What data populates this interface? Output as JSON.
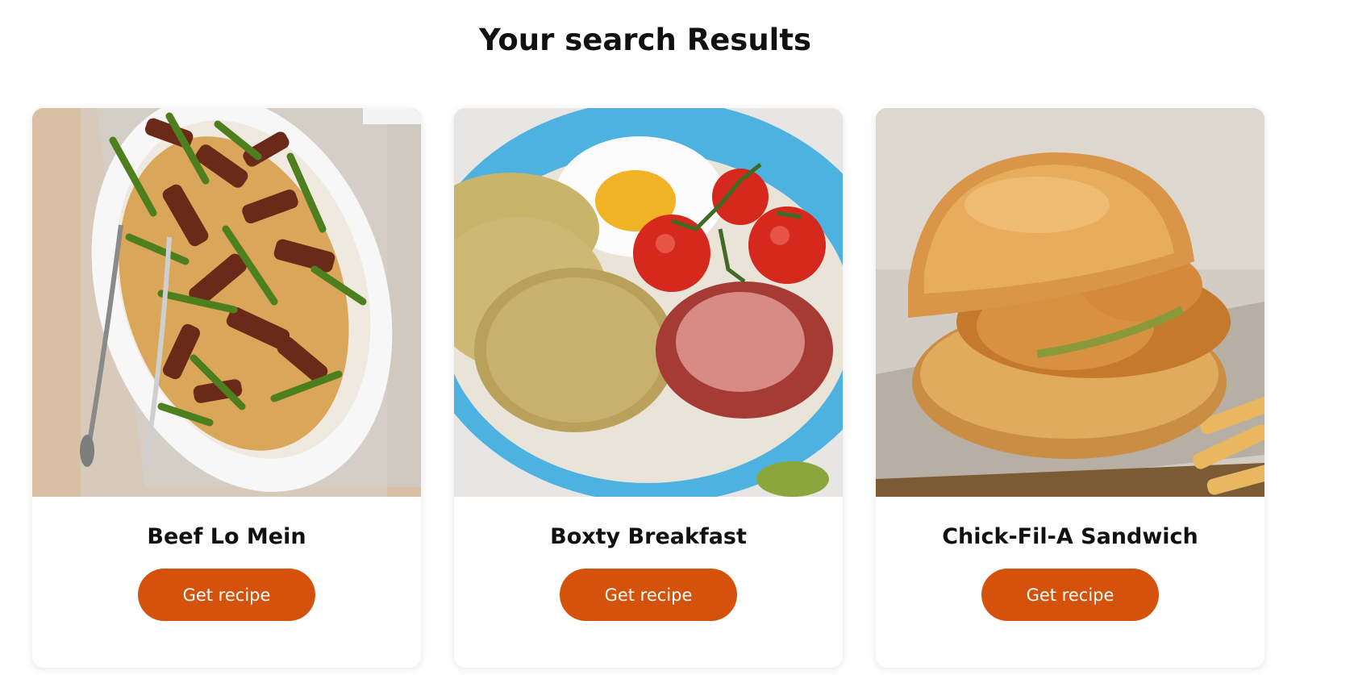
{
  "page": {
    "title": "Your search Results"
  },
  "colors": {
    "accent": "#d4520b",
    "card_background": "#ffffff",
    "text": "#111111"
  },
  "results": [
    {
      "title": "Beef Lo Mein",
      "button_label": "Get recipe",
      "image": "beef-lo-mein-photo"
    },
    {
      "title": "Boxty Breakfast",
      "button_label": "Get recipe",
      "image": "boxty-breakfast-photo"
    },
    {
      "title": "Chick-Fil-A Sandwich",
      "button_label": "Get recipe",
      "image": "chick-fil-a-sandwich-photo"
    }
  ]
}
